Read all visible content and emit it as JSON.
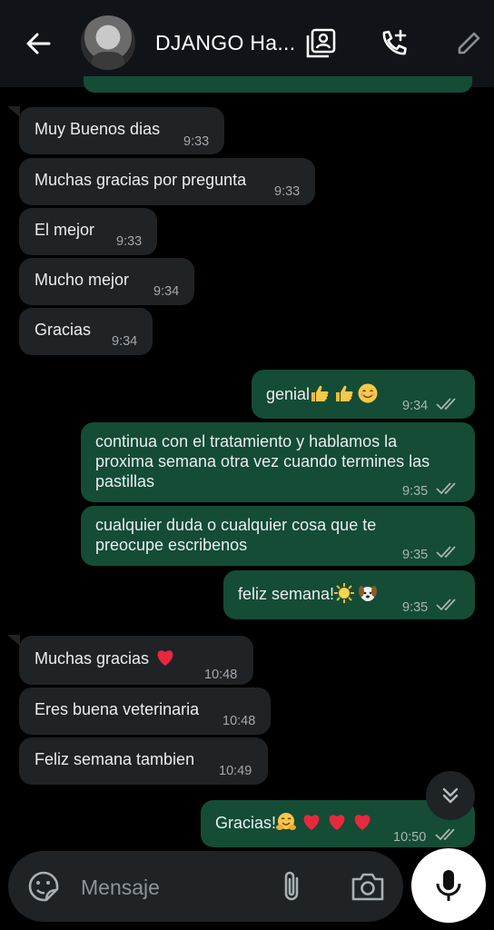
{
  "header": {
    "contact_name": "DJANGO Ha...",
    "icons": [
      "back-arrow-icon",
      "contact-card-icon",
      "add-call-icon",
      "edit-pencil-icon"
    ]
  },
  "messages": [
    {
      "dir": "in",
      "text": "Muy Buenos dias",
      "time": "9:33"
    },
    {
      "dir": "in",
      "text": "Muchas gracias por pregunta",
      "time": "9:33"
    },
    {
      "dir": "in",
      "text": "El mejor",
      "time": "9:33"
    },
    {
      "dir": "in",
      "text": "Mucho mejor",
      "time": "9:34"
    },
    {
      "dir": "in",
      "text": "Gracias",
      "time": "9:34"
    },
    {
      "dir": "out",
      "text": "genial",
      "emojis": "thumbs-up thumbs-up smiling-face",
      "time": "9:34",
      "status": "read"
    },
    {
      "dir": "out",
      "lines": [
        "continua con el tratamiento y hablamos la",
        "proxima semana otra vez cuando termines las",
        "pastillas"
      ],
      "time": "9:35",
      "status": "read"
    },
    {
      "dir": "out",
      "lines": [
        "cualquier duda o cualquier cosa que te",
        "preocupe escribenos"
      ],
      "time": "9:35",
      "status": "read"
    },
    {
      "dir": "out",
      "text": "feliz semana!",
      "emojis": "sun dog",
      "time": "9:35",
      "status": "read"
    },
    {
      "dir": "in",
      "text": "Muchas gracias",
      "emojis": "red-heart",
      "time": "10:48"
    },
    {
      "dir": "in",
      "text": "Eres buena veterinaria",
      "time": "10:48"
    },
    {
      "dir": "in",
      "text": "Feliz semana tambien",
      "time": "10:49"
    },
    {
      "dir": "out",
      "text": "Gracias!",
      "emojis": "hugging-face red-heart red-heart red-heart",
      "time": "10:50",
      "status": "read"
    }
  ],
  "composer": {
    "placeholder": "Mensaje",
    "icons": [
      "sticker-icon",
      "attach-icon",
      "camera-icon",
      "mic-icon"
    ]
  },
  "colors": {
    "background": "#000000",
    "header": "#101418",
    "incoming_bubble": "#1f2326",
    "outgoing_bubble": "#144c36",
    "tick_color": "#a9b5b0"
  }
}
